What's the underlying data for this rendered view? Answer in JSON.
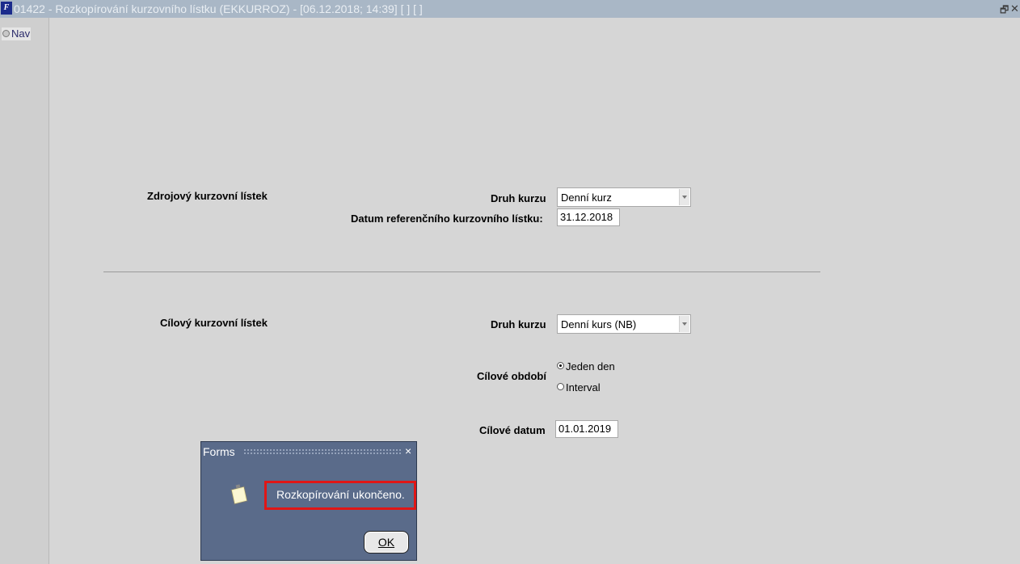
{
  "window": {
    "title": "01422 - Rozkopírování kurzovního lístku (EKKURROZ) - [06.12.2018; 14:39]  [ ]  [ ]",
    "restore_glyph": "Ὕ7",
    "close_glyph": "✕"
  },
  "nav": {
    "label": "Nav"
  },
  "source": {
    "section_label": "Zdrojový kurzovní  lístek",
    "rate_type_label": "Druh kurzu",
    "rate_type_value": "Denní kurz",
    "ref_date_label": "Datum referenčního kurzovního lístku:",
    "ref_date_value": "31.12.2018"
  },
  "target": {
    "section_label": "Cílový kurzovní  lístek",
    "rate_type_label": "Druh kurzu",
    "rate_type_value": "Denní kurs (NB)",
    "period_label": "Cílové období",
    "period_options": [
      {
        "label": "Jeden den",
        "selected": true
      },
      {
        "label": "Interval",
        "selected": false
      }
    ],
    "date_label": "Cílové datum",
    "date_value": "01.01.2019"
  },
  "dialog": {
    "title": "Forms",
    "close_glyph": "×",
    "message": "Rozkopírování ukončeno.",
    "ok_label": "OK",
    "colors": {
      "background": "#5a6b8a",
      "highlight": "#e01616"
    }
  }
}
